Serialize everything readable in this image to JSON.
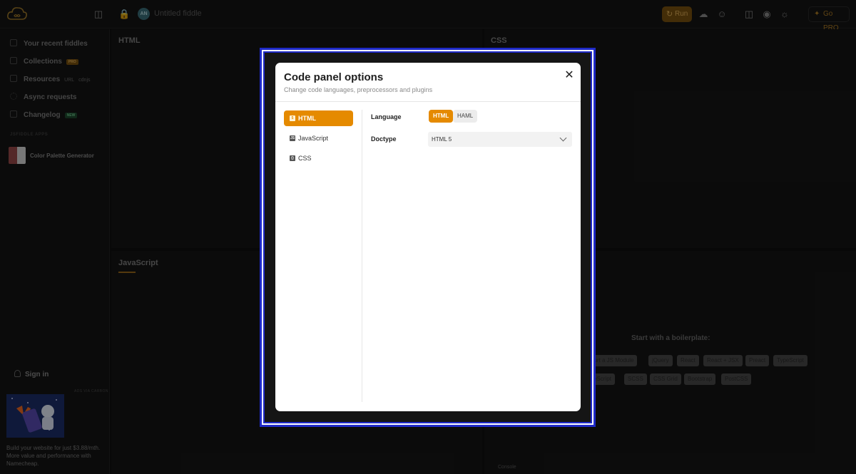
{
  "topbar": {
    "fiddle_title": "Untitled fiddle",
    "avatar_initials": "AN",
    "run_label": "Run",
    "pro_label": "Go PRO"
  },
  "sidebar": {
    "items": [
      {
        "label": "Your recent fiddles",
        "icon": "grid-icon"
      },
      {
        "label": "Collections",
        "badge": "PRO",
        "icon": "collection-icon"
      },
      {
        "label": "Resources",
        "chips": [
          "URL",
          "cdnjs"
        ],
        "icon": "resources-icon"
      },
      {
        "label": "Async requests",
        "icon": "async-icon"
      },
      {
        "label": "Changelog",
        "badge": "NEW",
        "icon": "changelog-icon"
      }
    ],
    "apps_heading": "JSFIDDLE APPS",
    "app_name": "Color Palette Generator",
    "signin_label": "Sign in",
    "ad_heading": "ADS VIA CARBON",
    "ad_text": "Build your website for just $3.88/mth. More value and performance with Namecheap."
  },
  "panes": {
    "html_label": "HTML",
    "css_label": "CSS",
    "js_label": "JavaScript",
    "boilerplate_title": "Start with a boilerplate:",
    "boilerplates_row1": [
      "port a JS Module",
      "jQuery",
      "React",
      "React + JSX",
      "Preact",
      "TypeScript"
    ],
    "boilerplates_row2": [
      "CoffeeScript",
      "SCSS",
      "CSS Grid",
      "Bootstrap",
      "PostCSS"
    ],
    "console_label": "Console"
  },
  "modal": {
    "title": "Code panel options",
    "subtitle": "Change code languages, preprocessors and plugins",
    "tabs": [
      {
        "label": "HTML",
        "icon": "html5-icon",
        "active": true
      },
      {
        "label": "JavaScript",
        "icon": "js-icon",
        "active": false
      },
      {
        "label": "CSS",
        "icon": "css-icon",
        "active": false
      }
    ],
    "language_label": "Language",
    "language_options": [
      "HTML",
      "HAML"
    ],
    "language_selected": "HTML",
    "doctype_label": "Doctype",
    "doctype_value": "HTML 5"
  },
  "colors": {
    "accent": "#e58a00",
    "focus_frame": "#1f2ac8"
  }
}
